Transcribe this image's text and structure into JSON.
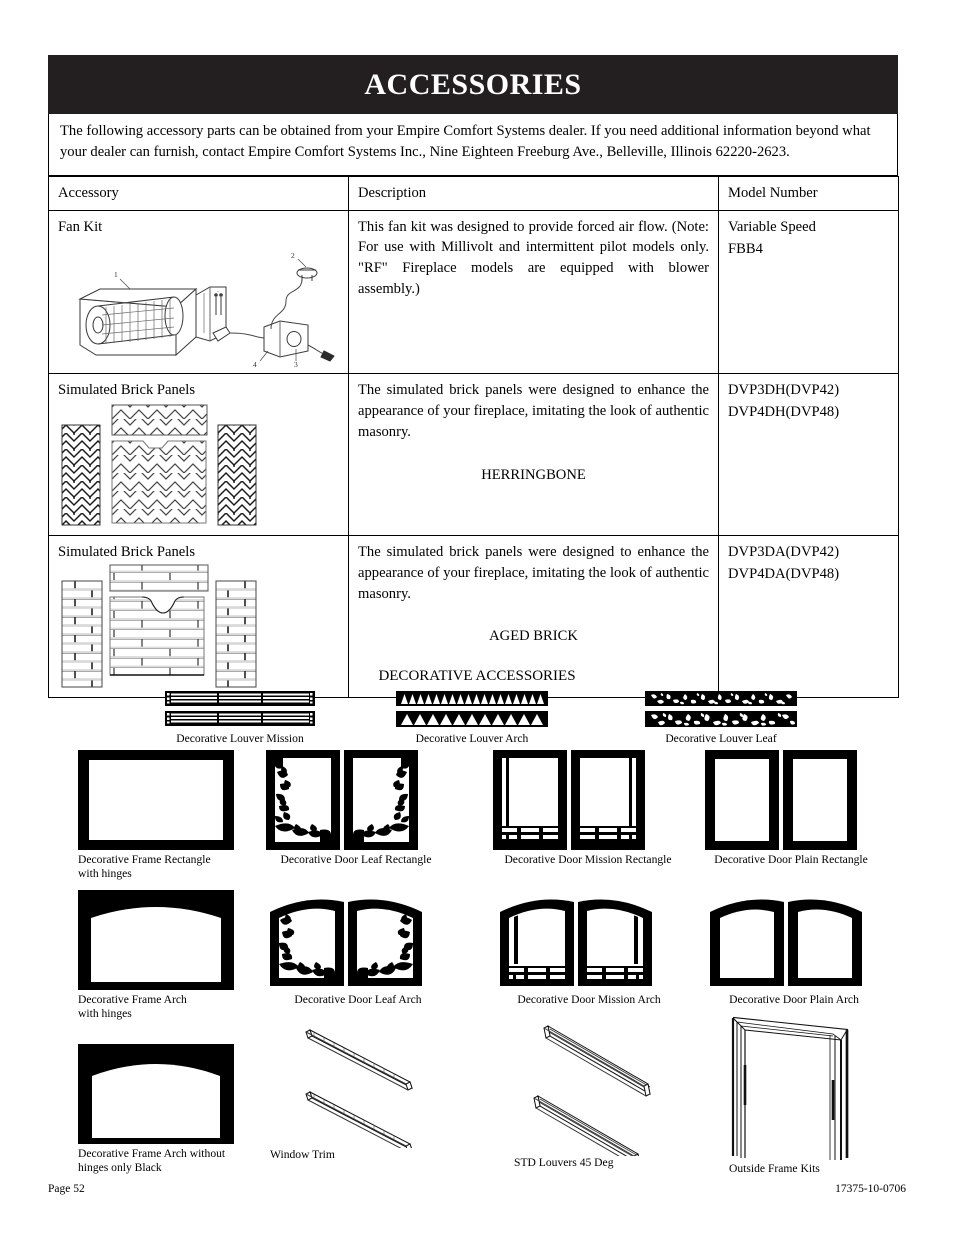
{
  "document": {
    "title": "ACCESSORIES",
    "intro": "The following accessory parts can be obtained from your Empire Comfort Systems dealer. If you need additional information beyond what your dealer can furnish, contact Empire Comfort Systems Inc., Nine Eighteen Freeburg Ave., Belleville, Illinois 62220-2623."
  },
  "table": {
    "headers": {
      "accessory": "Accessory",
      "description": "Description",
      "model_number": "Model Number"
    },
    "rows": [
      {
        "accessory": "Fan Kit",
        "figure": "fan-kit-illustration",
        "figure_callouts": [
          "1",
          "2",
          "3",
          "4"
        ],
        "description": "This fan kit was designed to provide forced air flow. (Note: For use with Millivolt and intermittent pilot models only. \"RF\" Fireplace models are equipped with blower assembly.)",
        "description_center_label": "",
        "model_numbers": [
          "Variable Speed",
          "FBB4"
        ]
      },
      {
        "accessory": "Simulated Brick Panels",
        "figure": "herringbone-brick-panels",
        "figure_callouts": [],
        "description": "The simulated brick panels were designed to enhance the appearance of your fireplace, imitating the look of authentic masonry.",
        "description_center_label": "HERRINGBONE",
        "model_numbers": [
          "DVP3DH(DVP42)",
          "DVP4DH(DVP48)"
        ]
      },
      {
        "accessory": "Simulated Brick Panels",
        "figure": "aged-brick-panels",
        "figure_callouts": [],
        "description": "The simulated brick panels were designed to enhance the appearance of your fireplace, imitating the look of authentic masonry.",
        "description_center_label": "AGED BRICK",
        "model_numbers": [
          "DVP3DA(DVP42)",
          "DVP4DA(DVP48)"
        ]
      }
    ]
  },
  "decorative": {
    "section_title": "DECORATIVE ACCESSORIES",
    "louvers": [
      {
        "caption": "Decorative Louver Mission",
        "icon": "louver-mission-icon"
      },
      {
        "caption": "Decorative Louver Arch",
        "icon": "louver-arch-icon"
      },
      {
        "caption": "Decorative Louver Leaf",
        "icon": "louver-leaf-icon"
      }
    ],
    "items": [
      {
        "caption_line1": "Decorative Frame Rectangle",
        "caption_line2": "with hinges",
        "icon": "frame-rectangle-icon"
      },
      {
        "caption_line1": "Decorative Door Leaf Rectangle",
        "caption_line2": "",
        "icon": "door-leaf-rectangle-icon"
      },
      {
        "caption_line1": "Decorative Door Mission Rectangle",
        "caption_line2": "",
        "icon": "door-mission-rectangle-icon"
      },
      {
        "caption_line1": "Decorative Door Plain Rectangle",
        "caption_line2": "",
        "icon": "door-plain-rectangle-icon"
      },
      {
        "caption_line1": "Decorative Frame Arch",
        "caption_line2": "with hinges",
        "icon": "frame-arch-icon"
      },
      {
        "caption_line1": "Decorative Door Leaf Arch",
        "caption_line2": "",
        "icon": "door-leaf-arch-icon"
      },
      {
        "caption_line1": "Decorative Door Mission Arch",
        "caption_line2": "",
        "icon": "door-mission-arch-icon"
      },
      {
        "caption_line1": "Decorative Door Plain Arch",
        "caption_line2": "",
        "icon": "door-plain-arch-icon"
      },
      {
        "caption_line1": "Decorative Frame Arch without",
        "caption_line2": "hinges only Black",
        "icon": "frame-arch-no-hinges-icon"
      },
      {
        "caption_line1": "Window Trim",
        "caption_line2": "",
        "icon": "window-trim-icon"
      },
      {
        "caption_line1": "STD Louvers 45 Deg",
        "caption_line2": "",
        "icon": "std-louvers-45-icon"
      },
      {
        "caption_line1": "Outside Frame Kits",
        "caption_line2": "",
        "icon": "outside-frame-kit-icon"
      }
    ]
  },
  "footer": {
    "page_label": "Page 52",
    "doc_number": "17375-10-0706"
  },
  "colors": {
    "banner_bg": "#231f20",
    "text": "#000000",
    "page_bg": "#ffffff"
  }
}
